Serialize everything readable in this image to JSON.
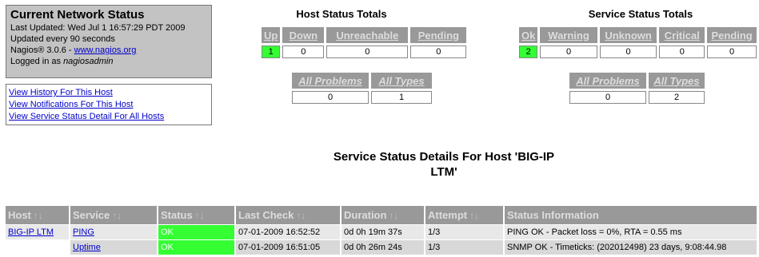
{
  "info": {
    "title": "Current Network Status",
    "last_updated": "Last Updated: Wed Jul 1 16:57:29 PDT 2009",
    "update_interval": "Updated every 90 seconds",
    "version_prefix": "Nagios® 3.0.6 - ",
    "version_link": "www.nagios.org",
    "logged_in_prefix": "Logged in as ",
    "user": "nagiosadmin"
  },
  "links": [
    "View History For This Host",
    "View Notifications For This Host",
    "View Service Status Detail For All Hosts"
  ],
  "host_totals": {
    "title": "Host Status Totals",
    "headers": [
      "Up",
      "Down",
      "Unreachable",
      "Pending"
    ],
    "values": [
      "1",
      "0",
      "0",
      "0"
    ],
    "sub_headers": [
      "All Problems",
      "All Types"
    ],
    "sub_values": [
      "0",
      "1"
    ]
  },
  "service_totals": {
    "title": "Service Status Totals",
    "headers": [
      "Ok",
      "Warning",
      "Unknown",
      "Critical",
      "Pending"
    ],
    "values": [
      "2",
      "0",
      "0",
      "0",
      "0"
    ],
    "sub_headers": [
      "All Problems",
      "All Types"
    ],
    "sub_values": [
      "0",
      "2"
    ]
  },
  "detail_title_line1": "Service Status Details For Host 'BIG-IP",
  "detail_title_line2": "LTM'",
  "sort_arrows": "↑↓",
  "table": {
    "columns": [
      "Host",
      "Service",
      "Status",
      "Last Check",
      "Duration",
      "Attempt",
      "Status Information"
    ],
    "rows": [
      {
        "host": "BIG-IP LTM",
        "service": "PING",
        "status": "OK",
        "last_check": "07-01-2009 16:52:52",
        "duration": "0d 0h 19m 37s",
        "attempt": "1/3",
        "info": "PING OK - Packet loss = 0%, RTA = 0.55 ms"
      },
      {
        "host": "",
        "service": "Uptime",
        "status": "OK",
        "last_check": "07-01-2009 16:51:05",
        "duration": "0d 0h 26m 24s",
        "attempt": "1/3",
        "info": "SNMP OK - Timeticks: (202012498) 23 days, 9:08:44.98"
      }
    ]
  },
  "colors": {
    "header_bg": "#999999",
    "ok_green": "#33ff33",
    "info_box_bg": "#c3c3c3"
  }
}
